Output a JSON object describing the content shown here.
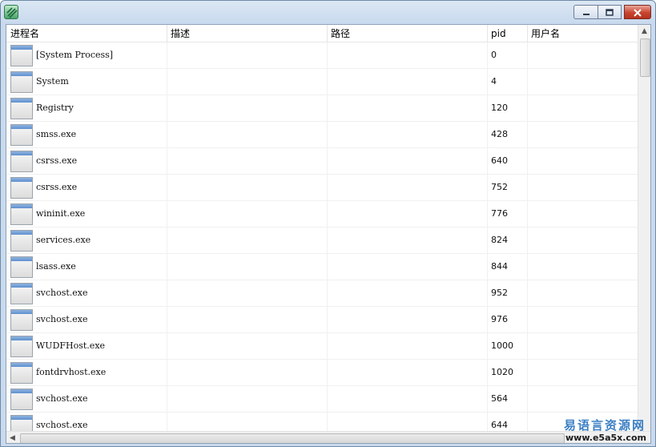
{
  "window": {
    "controls": {
      "minimize": "minimize-icon",
      "maximize": "maximize-icon",
      "close": "close-icon"
    }
  },
  "table": {
    "columns": [
      "进程名",
      "描述",
      "路径",
      "pid",
      "用户名"
    ],
    "rows": [
      {
        "name": "[System Process]",
        "pid": "0"
      },
      {
        "name": "System",
        "pid": "4"
      },
      {
        "name": "Registry",
        "pid": "120"
      },
      {
        "name": "smss.exe",
        "pid": "428"
      },
      {
        "name": "csrss.exe",
        "pid": "640"
      },
      {
        "name": "csrss.exe",
        "pid": "752"
      },
      {
        "name": "wininit.exe",
        "pid": "776"
      },
      {
        "name": "services.exe",
        "pid": "824"
      },
      {
        "name": "lsass.exe",
        "pid": "844"
      },
      {
        "name": "svchost.exe",
        "pid": "952"
      },
      {
        "name": "svchost.exe",
        "pid": "976"
      },
      {
        "name": "WUDFHost.exe",
        "pid": "1000"
      },
      {
        "name": "fontdrvhost.exe",
        "pid": "1020"
      },
      {
        "name": "svchost.exe",
        "pid": "564"
      },
      {
        "name": "svchost.exe",
        "pid": "644"
      }
    ]
  },
  "watermark": {
    "line1": "易语言资源网",
    "line2": "www.e5a5x.com"
  },
  "colors": {
    "watermark_blue": "#3b7fc4",
    "close_red": "#c8452f"
  }
}
